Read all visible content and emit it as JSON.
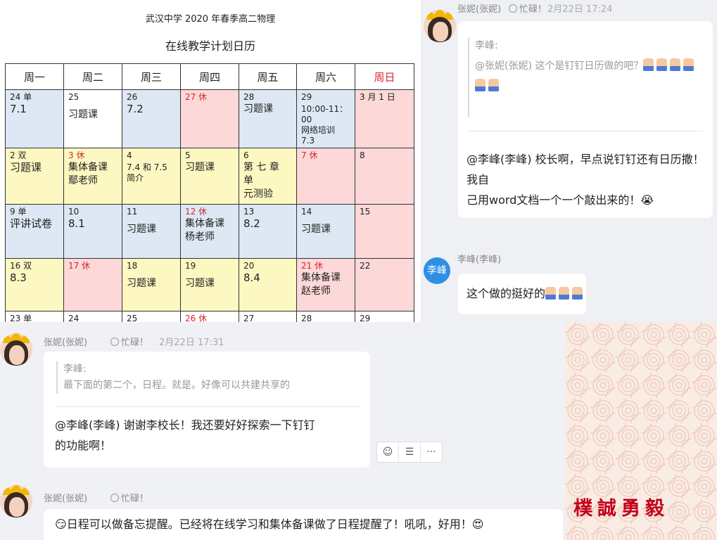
{
  "calendar": {
    "school": "武汉中学 2020 年春季高二物理",
    "title": "在线教学计划日历",
    "weekdays": [
      "周一",
      "周二",
      "周三",
      "周四",
      "周五",
      "周六",
      "周日"
    ],
    "rows": [
      [
        {
          "date": "24 单",
          "lines": [
            "7.1"
          ]
        },
        {
          "date": "25",
          "lines": [
            "习题课"
          ]
        },
        {
          "date": "26",
          "lines": [
            "7.2"
          ]
        },
        {
          "date": "27 休",
          "lines": []
        },
        {
          "date": "28",
          "lines": [
            "习题课"
          ]
        },
        {
          "date": "29",
          "lines": [
            "10:00-11：00",
            "网络培训",
            "7.3"
          ]
        },
        {
          "date": "3 月 1 日",
          "lines": []
        }
      ],
      [
        {
          "date": "2 双",
          "lines": [
            "习题课"
          ]
        },
        {
          "date": "3 休",
          "lines": [
            "集体备课",
            "鄢老师"
          ]
        },
        {
          "date": "4",
          "lines": [
            "7.4 和 7.5",
            "简介"
          ]
        },
        {
          "date": "5",
          "lines": [
            "习题课"
          ]
        },
        {
          "date": "6",
          "lines": [
            "第 七 章 单",
            "元测验"
          ]
        },
        {
          "date": "7 休",
          "lines": []
        },
        {
          "date": "8",
          "lines": []
        }
      ],
      [
        {
          "date": "9 单",
          "lines": [
            "评讲试卷"
          ]
        },
        {
          "date": "10",
          "lines": [
            "8.1"
          ]
        },
        {
          "date": "11",
          "lines": [
            "习题课"
          ]
        },
        {
          "date": "12 休",
          "lines": [
            "集体备课",
            "杨老师"
          ]
        },
        {
          "date": "13",
          "lines": [
            "8.2"
          ]
        },
        {
          "date": "14",
          "lines": [
            "习题课"
          ]
        },
        {
          "date": "15",
          "lines": []
        }
      ],
      [
        {
          "date": "16 双",
          "lines": [
            "8.3"
          ]
        },
        {
          "date": "17 休",
          "lines": []
        },
        {
          "date": "18",
          "lines": [
            "习题课"
          ]
        },
        {
          "date": "19",
          "lines": [
            "习题课"
          ]
        },
        {
          "date": "20",
          "lines": [
            "8.4"
          ]
        },
        {
          "date": "21 休",
          "lines": [
            "集体备课",
            "赵老师"
          ]
        },
        {
          "date": "22",
          "lines": []
        }
      ],
      [
        {
          "date": "23 单",
          "lines": []
        },
        {
          "date": "24",
          "lines": []
        },
        {
          "date": "25",
          "lines": []
        },
        {
          "date": "26 休",
          "lines": []
        },
        {
          "date": "27",
          "lines": []
        },
        {
          "date": "28",
          "lines": []
        },
        {
          "date": "29",
          "lines": []
        }
      ]
    ]
  },
  "chat_top": {
    "msg1": {
      "sender": "张妮(张妮)",
      "status": "忙碌！",
      "time": "2月22日 17:24",
      "quote_name": "李峰:",
      "quote_text": "@张妮(张妮) 这个是钉钉日历做的吧？",
      "text_line1": "@李峰(李峰) 校长啊，早点说钉钉还有日历撒！我自",
      "text_line2": "己用word文档一个一个敲出来的！",
      "emoji": "😭"
    },
    "msg2": {
      "avatar_text": "李峰",
      "sender": "李峰(李峰)",
      "text": "这个做的挺好的"
    }
  },
  "chat_bottom": {
    "msg1": {
      "sender": "张妮(张妮)",
      "status": "忙碌！",
      "time": "2月22日 17:31",
      "quote_name": "李峰:",
      "quote_text": "最下面的第二个，日程。就是。好像可以共建共享的",
      "text_line1": "@李峰(李峰) 谢谢李校长！我还要好好探索一下钉钉",
      "text_line2": "的功能啊！"
    },
    "actions": [
      "☺",
      "☰",
      "···"
    ],
    "msg2": {
      "sender": "张妮(张妮)",
      "status": "忙碌！",
      "emoji_start": "😏",
      "text": "日程可以做备忘提醒。已经将在线学习和集体备课做了日程提醒了！吼吼，好用！",
      "emoji_end": "😍"
    }
  },
  "motto": "樸誠勇毅",
  "colors": {
    "cell_blue": "#dde8f4",
    "cell_yellow": "#fdf8c2",
    "cell_pink": "#fcd8d8",
    "sunday_red": "#d9262a",
    "motto_red": "#c4001a",
    "avatar_blue": "#2f8fe5"
  }
}
